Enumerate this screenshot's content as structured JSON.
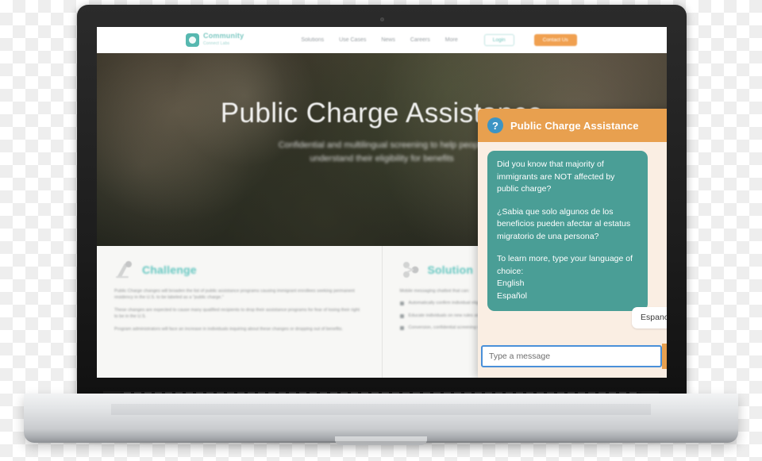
{
  "site": {
    "nav": {
      "logo_name": "Community",
      "logo_sub": "Connect Labs",
      "links": [
        {
          "label": "Solutions"
        },
        {
          "label": "Use Cases"
        },
        {
          "label": "News"
        },
        {
          "label": "Careers"
        },
        {
          "label": "More"
        }
      ],
      "login_label": "Login",
      "cta_label": "Contact Us"
    },
    "hero": {
      "title": "Public Charge Assistance",
      "subtitle_line1": "Confidential and multilingual screening to help people",
      "subtitle_line2": "understand their eligibility for benefits"
    },
    "cards": [
      {
        "icon": "megaphone-icon",
        "title": "Challenge",
        "paragraphs": [
          "Public Charge changes will broaden the list of public assistance programs causing immigrant enrollees seeking permanent residency in the U.S. to be labeled as a \"public charge.\"",
          "These changes are expected to cause many qualified recipients to drop their assistance programs for fear of losing their right to be in the U.S.",
          "Program administrators will face an increase in individuals inquiring about these changes or dropping out of benefits."
        ]
      },
      {
        "icon": "network-icon",
        "title": "Solution",
        "intro": "Mobile messaging chatbot that can:",
        "bullets": [
          "Automatically confirm individual eligibility",
          "Educate individuals on new rules around public assistance",
          "Conversion, confidential screening via chat or SMS in the user's language including Spanish and Chinese"
        ]
      }
    ]
  },
  "chat": {
    "avatar_icon": "question-mark-icon",
    "title": "Public Charge Assistance",
    "close_icon": "close-icon",
    "bot_message": {
      "paragraph1": "Did you know that majority of immigrants are NOT affected by public charge?",
      "paragraph2": "¿Sabia que solo algunos de los beneficios pueden afectar al estatus migratorio de una persona?",
      "paragraph3": "To learn more, type your language of choice:",
      "option1": "English",
      "option2": "Español"
    },
    "user_message": "Espanol",
    "input_placeholder": "Type a message",
    "input_value": "",
    "send_icon": "send-arrow-icon"
  },
  "colors": {
    "header_orange": "#e8a04f",
    "bot_bubble_teal": "#4a9e96",
    "chat_background": "#faeee3",
    "avatar_blue": "#3d94c4",
    "input_focus_blue": "#4a90d9",
    "brand_teal": "#63c6c0"
  }
}
